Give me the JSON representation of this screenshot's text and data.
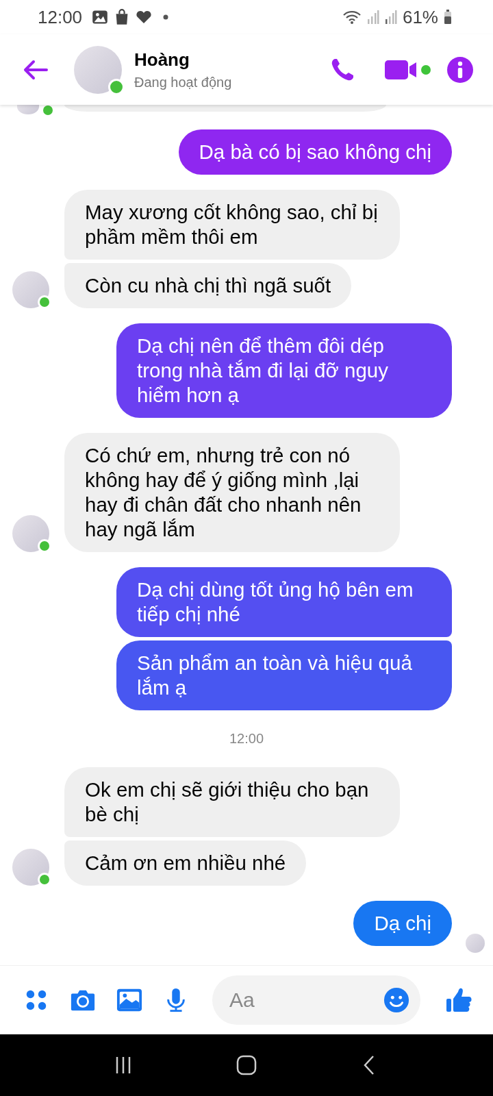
{
  "status_bar": {
    "time": "12:00",
    "battery": "61%"
  },
  "header": {
    "name": "Hoàng",
    "status": "Đang hoạt động",
    "online": true
  },
  "messages": [
    {
      "kind": "received",
      "cut": true,
      "avatar": true,
      "online": true
    },
    {
      "kind": "sent",
      "text": "Dạ bà có bị sao không chị"
    },
    {
      "kind": "received",
      "text": "May xương cốt không sao, chỉ bị phầm mềm thôi em",
      "avatar": false,
      "online": false
    },
    {
      "kind": "received",
      "text": "Còn cu nhà chị thì ngã suốt",
      "avatar": true,
      "online": true
    },
    {
      "kind": "sent",
      "text": "Dạ chị nên để thêm đôi dép trong nhà tắm đi lại đỡ nguy hiểm hơn ạ"
    },
    {
      "kind": "received",
      "text": "Có chứ em, nhưng trẻ con nó không hay để ý giống mình ,lại hay đi chân đất cho nhanh nên hay ngã lắm",
      "avatar": true,
      "online": true
    },
    {
      "kind": "sent",
      "text": "Dạ chị dùng tốt ủng hộ bên em tiếp chị nhé"
    },
    {
      "kind": "sent",
      "text": "Sản phẩm an toàn và hiệu quả lắm ạ"
    },
    {
      "kind": "time",
      "text": "12:00"
    },
    {
      "kind": "received",
      "text": "Ok em chị sẽ giới thiệu cho bạn bè chị",
      "avatar": false,
      "online": false
    },
    {
      "kind": "received",
      "text": "Cảm ơn em nhiều nhé",
      "avatar": true,
      "online": true
    },
    {
      "kind": "sent",
      "text": "Dạ chị",
      "seen": true
    }
  ],
  "composer": {
    "placeholder": "Aa"
  }
}
